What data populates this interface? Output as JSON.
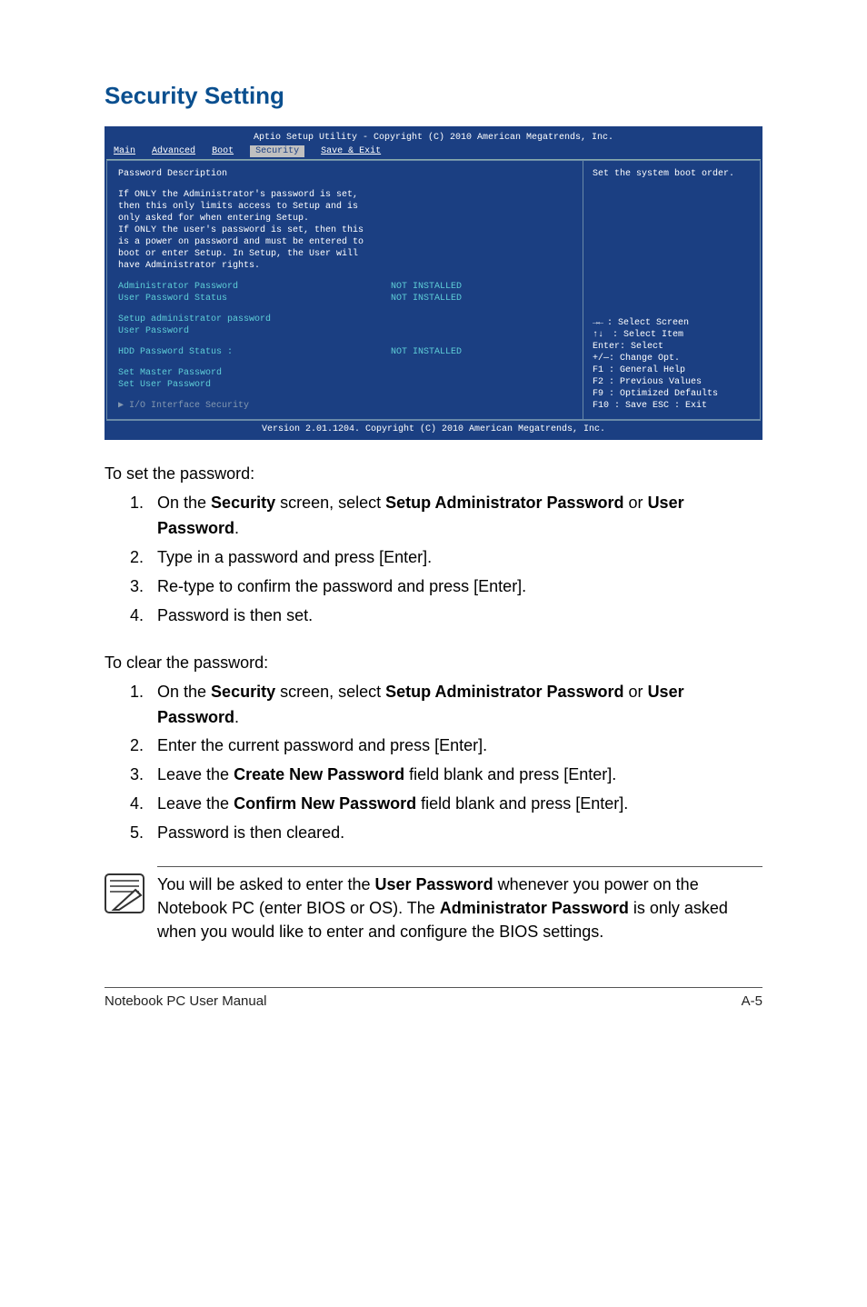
{
  "heading": "Security Setting",
  "bios": {
    "title": "Aptio Setup Utility - Copyright (C) 2010 American Megatrends, Inc.",
    "tabs": [
      "Main",
      "Advanced",
      "Boot",
      "Security",
      "Save & Exit"
    ],
    "active_tab": "Security",
    "desc_title": "Password Description",
    "desc_lines": [
      "If ONLY the Administrator's password is set,",
      "then this only limits access to Setup and is",
      "only asked for when entering Setup.",
      "If ONLY the user's password is set, then this",
      "is a power on password and must be entered to",
      "boot or enter Setup. In Setup, the User will",
      "have Administrator rights."
    ],
    "rows": {
      "admin_label": "Administrator Password",
      "admin_value": "NOT INSTALLED",
      "user_status_label": "User Password Status",
      "user_status_value": "NOT INSTALLED",
      "setup_admin": "Setup administrator password",
      "user_password": "User Password",
      "hdd_label": "HDD Password Status :",
      "hdd_value": "NOT INSTALLED",
      "set_master": "Set Master Password",
      "set_user": "Set User Password",
      "io_security": "I/O Interface Security"
    },
    "right_help_top": "Set the system boot order.",
    "help": {
      "select_screen": ": Select Screen",
      "select_item": ":    Select Item",
      "enter": "Enter: Select",
      "change": "+/—:  Change Opt.",
      "f1": "F1 :    General Help",
      "f2": "F2 :    Previous Values",
      "f9": "F9 :    Optimized Defaults",
      "f10": "F10 :  Save    ESC :  Exit"
    },
    "footer": "Version 2.01.1204. Copyright (C) 2010 American Megatrends, Inc."
  },
  "set_pw_intro": "To set the password:",
  "set_pw_steps": {
    "s1a": "On the ",
    "s1b": "Security",
    "s1c": " screen, select ",
    "s1d": "Setup Administrator Password",
    "s1e": " or ",
    "s1f": "User Password",
    "s1g": ".",
    "s2": "Type in a password and press [Enter].",
    "s3": "Re-type to confirm the password and press [Enter].",
    "s4": "Password is then set."
  },
  "clear_pw_intro": "To clear the password:",
  "clear_pw_steps": {
    "s1a": "On the ",
    "s1b": "Security",
    "s1c": " screen, select ",
    "s1d": "Setup Administrator Password",
    "s1e": " or ",
    "s1f": "User Password",
    "s1g": ".",
    "s2": "Enter the current password and press [Enter].",
    "s3a": "Leave the ",
    "s3b": "Create New Password",
    "s3c": " field blank and press [Enter].",
    "s4a": "Leave the ",
    "s4b": "Confirm New Password",
    "s4c": " field blank and press [Enter].",
    "s5": "Password is then cleared."
  },
  "note": {
    "t1": "You will be asked to enter the ",
    "t2": "User Password",
    "t3": " whenever you power on the Notebook PC (enter BIOS or OS). The ",
    "t4": "Administrator Password",
    "t5": " is only asked when you would like to enter and configure the BIOS settings."
  },
  "footer_left": "Notebook PC User Manual",
  "footer_right": "A-5"
}
